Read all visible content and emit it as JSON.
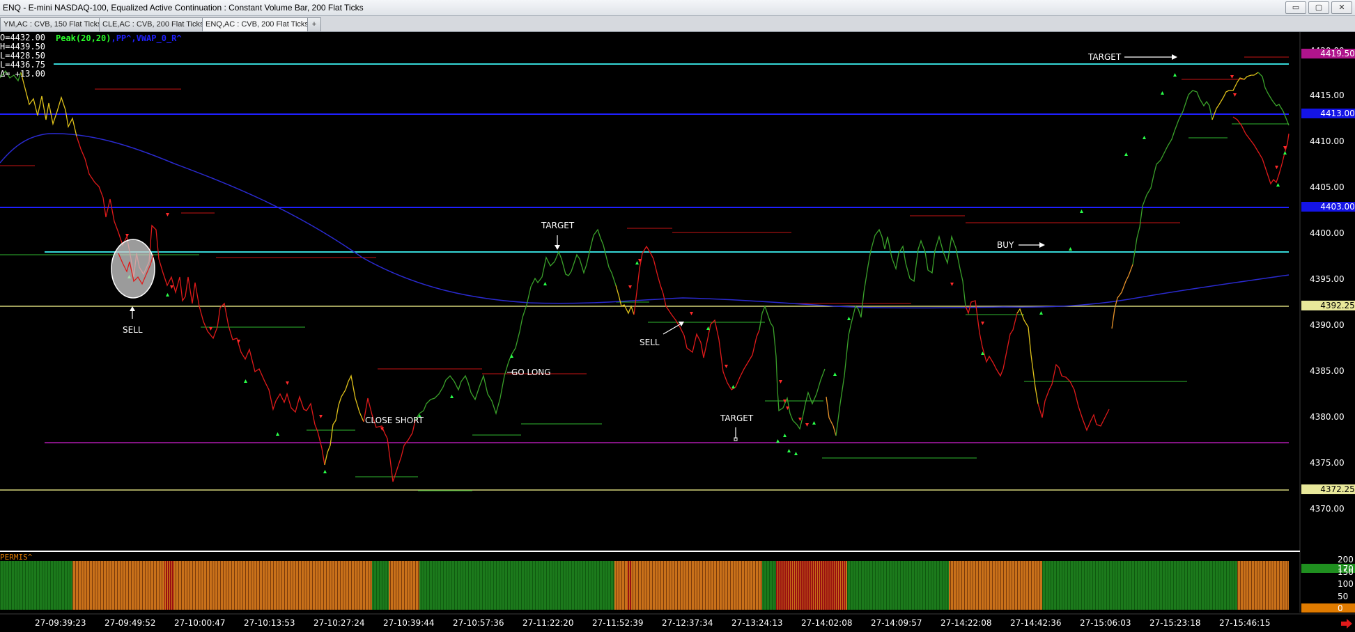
{
  "window": {
    "title": "ENQ - E-mini NASDAQ-100, Equalized Active Continuation : Constant Volume Bar, 200 Flat Ticks",
    "minimize_label": "▭",
    "restore_label": "▢",
    "close_label": "✕"
  },
  "tabs": [
    {
      "label": "YM,AC : CVB, 150 Flat Ticks"
    },
    {
      "label": "CLE,AC : CVB, 200 Flat Ticks"
    },
    {
      "label": "ENQ,AC : CVB, 200 Flat Ticks"
    }
  ],
  "add_tab_label": "+",
  "ohlc": {
    "open": "O=4432.00",
    "high": "H=4439.50",
    "low": "L=4428.50",
    "last": "L=4436.75",
    "delta": "Δ= +13.00"
  },
  "indicators": {
    "peak": "Peak(20,20)",
    "rest": ",PP^,VWAP_0_R^"
  },
  "price_axis": {
    "ticks": [
      "4420.00",
      "4415.00",
      "4410.00",
      "4405.00",
      "4400.00",
      "4395.00",
      "4390.00",
      "4385.00",
      "4380.00",
      "4375.00",
      "4370.00"
    ],
    "markers": [
      {
        "label": "4419.50",
        "bg": "#b0148c",
        "fg": "#ffffff"
      },
      {
        "label": "4413.00",
        "bg": "#1414e6",
        "fg": "#ffffff"
      },
      {
        "label": "4403.00",
        "bg": "#1414e6",
        "fg": "#ffffff"
      },
      {
        "label": "4392.25",
        "bg": "#e8e89a",
        "fg": "#000000"
      },
      {
        "label": "4372.25",
        "bg": "#e8e89a",
        "fg": "#000000"
      }
    ]
  },
  "lower_panel": {
    "title": "PERMIS^",
    "ticks": [
      "200",
      "170",
      "150",
      "100",
      "50",
      "0"
    ],
    "marker_170": {
      "label": "170",
      "bg": "#1f8f1f"
    },
    "marker_0": {
      "label": "0",
      "bg": "#e07b00"
    }
  },
  "time_axis": [
    "27-09:39:23",
    "27-09:49:52",
    "27-10:00:47",
    "27-10:13:53",
    "27-10:27:24",
    "27-10:39:44",
    "27-10:57:36",
    "27-11:22:20",
    "27-11:52:39",
    "27-12:37:34",
    "27-13:24:13",
    "27-14:02:08",
    "27-14:09:57",
    "27-14:22:08",
    "27-14:42:36",
    "27-15:06:03",
    "27-15:23:18",
    "27-15:46:15"
  ],
  "annotations": {
    "sell1": "SELL",
    "target1": "TARGET",
    "go_long": "GO LONG",
    "close_short": "CLOSE SHORT",
    "sell2": "SELL",
    "target2": "TARGET",
    "buy": "BUY",
    "target3": "TARGET"
  },
  "colors": {
    "cyan_level": "#36d7d7",
    "blue_level": "#1f1fff",
    "yellow_level": "#d6d67a",
    "magenta_level": "#b01ab0",
    "vwap": "#2a2ad0",
    "bull": "#3aa12a",
    "bear": "#e01a1a",
    "neutral": "#e0c21a"
  },
  "nav_arrow_icon": "red-right-arrow-icon"
}
